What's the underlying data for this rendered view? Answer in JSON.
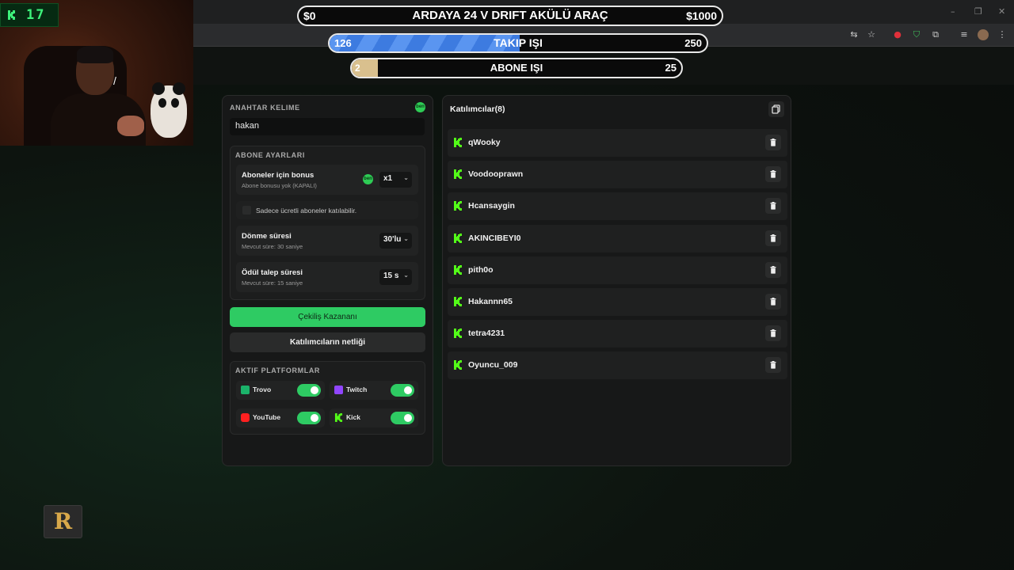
{
  "webcam": {
    "counter": "17"
  },
  "goals": [
    {
      "left": "$0",
      "title": "ARDAYA 24 V DRIFT AKÜLÜ ARAÇ",
      "right": "$1000",
      "progress": 0
    },
    {
      "left": "126",
      "title": "TAKIP IŞI",
      "right": "250",
      "progress": 0.504
    },
    {
      "left": "2",
      "title": "ABONE IŞI",
      "right": "25",
      "progress": 0.08
    }
  ],
  "settings": {
    "keyword_label": "ANAHTAR KELIME",
    "keyword_badge": "ben",
    "keyword_value": "hakan",
    "sub_section": "ABONE AYARLARI",
    "bonus_title": "Aboneler için bonus",
    "bonus_sub": "Abone bonusu yok (KAPALI)",
    "bonus_badge": "ben",
    "bonus_select": "x1",
    "paid_only_label": "Sadece ücretli aboneler katılabilir.",
    "spin_title": "Dönme süresi",
    "spin_sub": "Mevcut süre: 30 saniye",
    "spin_select": "30'lu",
    "claim_title": "Ödül talep süresi",
    "claim_sub": "Mevcut süre: 15 saniye",
    "claim_select": "15 s",
    "draw_button": "Çekiliş Kazananı",
    "clear_button": "Katılımcıların netliği",
    "platforms_label": "AKTIF PLATFORMLAR",
    "platforms": [
      {
        "name": "Trovo",
        "color": "#1bb36a",
        "enabled": true
      },
      {
        "name": "Twitch",
        "color": "#9146ff",
        "enabled": true
      },
      {
        "name": "YouTube",
        "color": "#ff2020",
        "enabled": true
      },
      {
        "name": "Kick",
        "color": "#53fc18",
        "enabled": true
      }
    ]
  },
  "participants": {
    "header": "Katılımcılar(8)",
    "list": [
      "qWooky",
      "Voodooprawn",
      "Hcansaygin",
      "AKINCIBEYI0",
      "pith0o",
      "Hakannn65",
      "tetra4231",
      "Oyuncu_009"
    ]
  },
  "colors": {
    "accent": "#2ecb63",
    "kick": "#53fc18",
    "goal_blue": "#3d7be0",
    "goal_tan": "#d9c08e"
  }
}
